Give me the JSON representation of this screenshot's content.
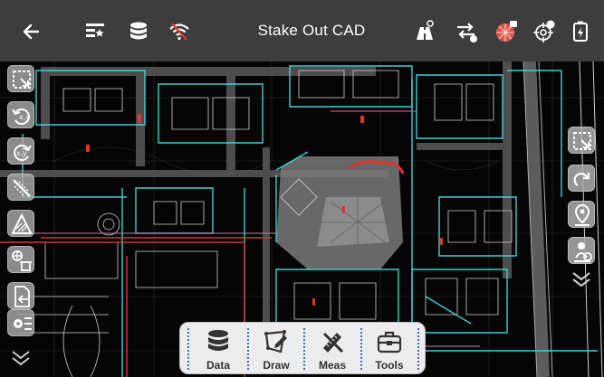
{
  "app": {
    "title": "Stake Out CAD"
  },
  "topbar": {
    "left_icons": [
      "back-arrow-icon",
      "layer-list-icon",
      "database-icon",
      "wifi-off-icon"
    ],
    "right_icons": [
      "binoculars-icon",
      "swap-icon",
      "pie-lock-icon",
      "crosshair-diff-icon",
      "battery-icon"
    ]
  },
  "left_tools": [
    "zoom-window-icon",
    "rotate-ccw-icon",
    "rotate-cw-icon",
    "hide-lines-icon",
    "hatch-icon",
    "point-delete-icon",
    "file-import-icon",
    "settings-list-icon"
  ],
  "right_tools": [
    "zoom-extents-icon",
    "undo-curve-icon",
    "location-pin-icon",
    "user-pin-icon"
  ],
  "toolbar": {
    "data_label": "Data",
    "draw_label": "Draw",
    "meas_label": "Meas",
    "tools_label": "Tools"
  },
  "colors": {
    "topbar": "#3d3d3d",
    "map_bg": "#050505",
    "cad_cyan": "#3fd0d8",
    "cad_red": "#e0342c",
    "accent_blue": "#3a6fc2"
  }
}
